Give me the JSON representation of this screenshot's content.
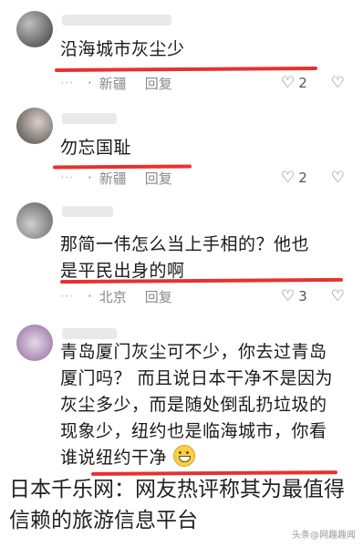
{
  "comments": [
    {
      "text": "沿海城市灰尘少",
      "region": "新疆",
      "reply": "回复",
      "likes": "2"
    },
    {
      "text": "勿忘国耻",
      "region": "新疆",
      "reply": "回复",
      "likes": "2"
    },
    {
      "text": "那简一伟怎么当上手相的？他也是平民出身的啊",
      "region": "北京",
      "reply": "回复",
      "likes": "3"
    },
    {
      "text": "青岛厦门灰尘可不少，你去过青岛厦门吗？ 而且说日本干净不是因为 灰尘多少，而是随处倒乱扔垃圾的现象少，纽约也是临海城市，你看谁说纽约干净"
    }
  ],
  "caption": "日本千乐网：网友热评称其为最值得信赖的旅游信息平台",
  "watermark": "头条@网趣趣闻",
  "colors": {
    "underline": "#e8312f",
    "meta": "#8a8a8a"
  },
  "icons": {
    "like": "heart-icon",
    "dislike": "broken-heart-icon",
    "emoji": "grinning-emoji-icon"
  }
}
